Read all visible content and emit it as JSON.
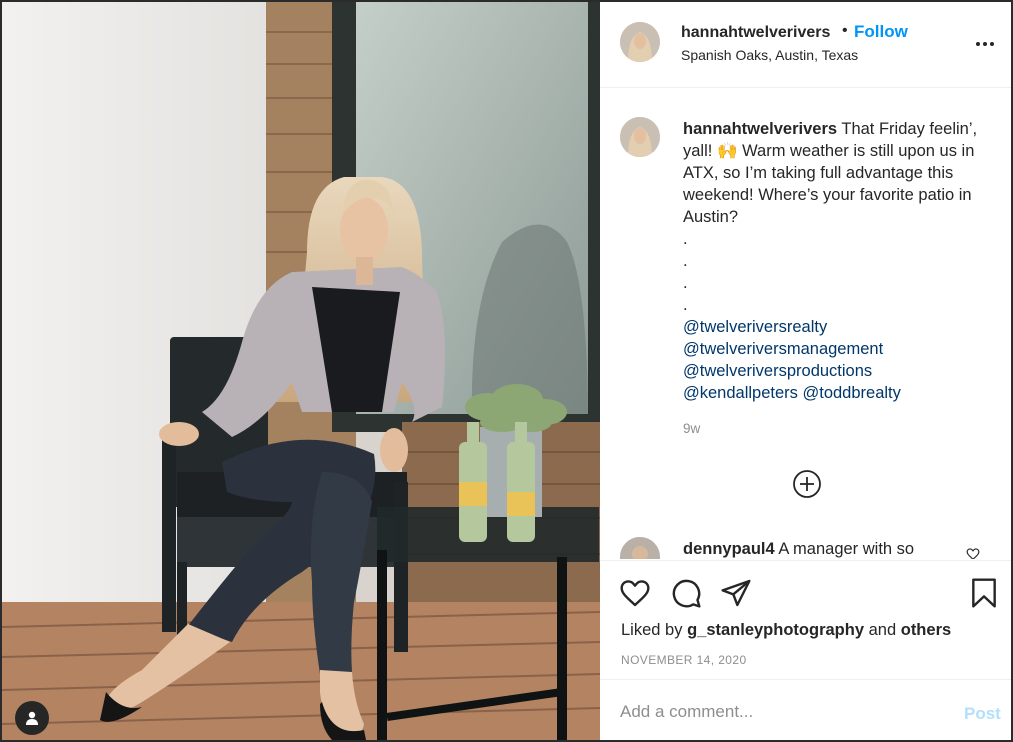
{
  "post": {
    "username": "hannahtwelverivers",
    "follow_separator": "•",
    "follow_label": "Follow",
    "location": "Spanish Oaks, Austin, Texas",
    "more_icon": "ellipsis-icon"
  },
  "caption": {
    "username": "hannahtwelverivers",
    "text_part1": "That Friday feelin’, yall!",
    "text_part2": "Warm weather is still upon us in ATX, so I’m taking full advantage this weekend! Where’s your favorite patio in Austin?",
    "dots": [
      ".",
      ".",
      ".",
      "."
    ],
    "mentions": [
      "@twelveriversrealty",
      "@twelveriversmanagement",
      "@twelveriversproductions"
    ],
    "mention_row": [
      "@kendallpeters",
      "@toddbrealty"
    ],
    "time": "9w"
  },
  "comment2": {
    "username": "dennypaul4",
    "text": "A manager with so"
  },
  "actions": {
    "liked_by_prefix": "Liked by",
    "liked_by_user": "g_stanleyphotography",
    "liked_by_and": "and",
    "liked_by_others": "others",
    "date": "NOVEMBER 14, 2020"
  },
  "add_comment": {
    "placeholder": "Add a comment...",
    "post_label": "Post"
  },
  "colors": {
    "follow": "#0095f6",
    "mention": "#00376b",
    "post_disabled": "#b2dffc",
    "muted": "#8e8e8e"
  }
}
